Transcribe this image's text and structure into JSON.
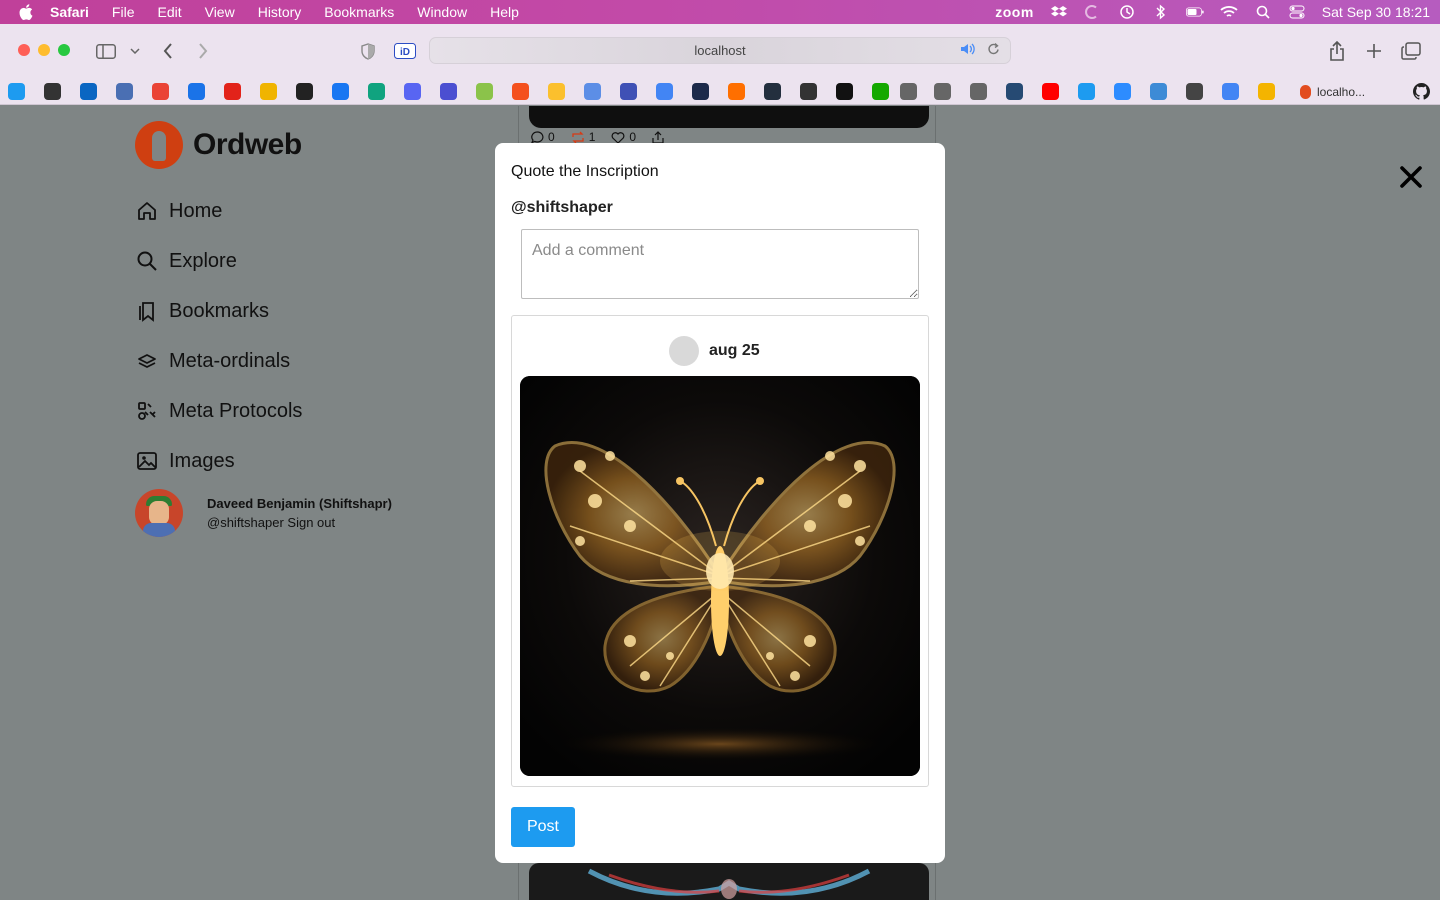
{
  "menubar": {
    "app": "Safari",
    "items": [
      "File",
      "Edit",
      "View",
      "History",
      "Bookmarks",
      "Window",
      "Help"
    ],
    "zoom": "zoom",
    "clock": "Sat Sep 30  18:21"
  },
  "browser": {
    "url": "localhost",
    "tab_label": "localho..."
  },
  "bookmarks": [
    {
      "name": "twitter",
      "color": "#1d9bf0"
    },
    {
      "name": "chrome",
      "color": "#333333"
    },
    {
      "name": "linkedin",
      "color": "#0a66c2"
    },
    {
      "name": "mail",
      "color": "#4a6fb3"
    },
    {
      "name": "gmail",
      "color": "#ea4335"
    },
    {
      "name": "calendar",
      "color": "#1a73e8"
    },
    {
      "name": "acrobat",
      "color": "#e2231a"
    },
    {
      "name": "badge",
      "color": "#f0b400"
    },
    {
      "name": "openai",
      "color": "#222222"
    },
    {
      "name": "facebook",
      "color": "#1877f2"
    },
    {
      "name": "chatgpt",
      "color": "#10a37f"
    },
    {
      "name": "discord",
      "color": "#5865f2"
    },
    {
      "name": "app-blue",
      "color": "#4b4fd1"
    },
    {
      "name": "app-green",
      "color": "#8bc34a"
    },
    {
      "name": "app-orange",
      "color": "#f4511e"
    },
    {
      "name": "app-yellow",
      "color": "#fbc02d"
    },
    {
      "name": "layers",
      "color": "#5c8ee6"
    },
    {
      "name": "at",
      "color": "#3f51b5"
    },
    {
      "name": "docs",
      "color": "#4285f4"
    },
    {
      "name": "dark-d",
      "color": "#1c2a4a"
    },
    {
      "name": "orange-page",
      "color": "#ff6f00"
    },
    {
      "name": "amazon",
      "color": "#232f3e"
    },
    {
      "name": "spiral",
      "color": "#333333"
    },
    {
      "name": "info",
      "color": "#111111"
    },
    {
      "name": "upwork",
      "color": "#14a800"
    },
    {
      "name": "wix1",
      "color": "#666666"
    },
    {
      "name": "wix2",
      "color": "#666666"
    },
    {
      "name": "wix3",
      "color": "#666666"
    },
    {
      "name": "terminal",
      "color": "#264a73"
    },
    {
      "name": "youtube",
      "color": "#ff0000"
    },
    {
      "name": "twitter2",
      "color": "#1d9bf0"
    },
    {
      "name": "z",
      "color": "#2d8cff"
    },
    {
      "name": "bulb",
      "color": "#3d8bd6"
    },
    {
      "name": "gear",
      "color": "#444444"
    },
    {
      "name": "docs2",
      "color": "#4285f4"
    },
    {
      "name": "slides",
      "color": "#f4b400"
    }
  ],
  "app": {
    "logo": "Ordweb",
    "nav": [
      {
        "label": "Home",
        "icon": "home-icon"
      },
      {
        "label": "Explore",
        "icon": "search-icon"
      },
      {
        "label": "Bookmarks",
        "icon": "bookmark-icon"
      },
      {
        "label": "Meta-ordinals",
        "icon": "layers-icon"
      },
      {
        "label": "Meta Protocols",
        "icon": "protocols-icon"
      },
      {
        "label": "Images",
        "icon": "image-icon"
      }
    ],
    "user": {
      "name": "Daveed Benjamin (Shiftshapr)",
      "handle_line": "@shiftshaper Sign out"
    },
    "feed_stats": {
      "comments": "0",
      "reposts": "1",
      "likes": "0"
    }
  },
  "modal": {
    "title": "Quote the Inscription",
    "handle": "@shiftshaper",
    "comment_placeholder": "Add a comment",
    "quote_date": "aug 25",
    "image_name": "golden-butterfly-inscription",
    "post_label": "Post"
  }
}
